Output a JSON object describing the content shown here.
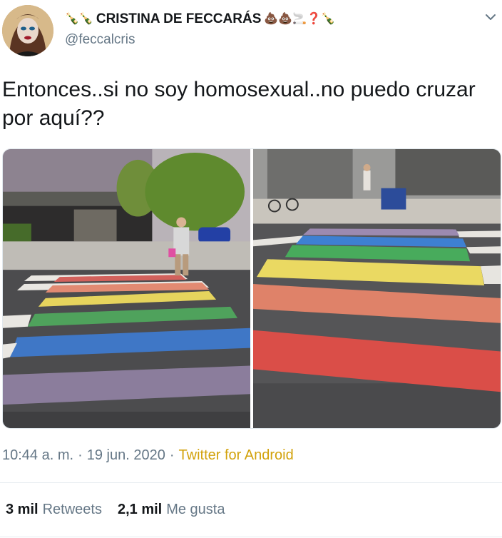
{
  "author": {
    "display_name": "CRISTINA DE FECCARÁS",
    "emoji_before": "🍾🍾",
    "emoji_after": "💩💩🚬❓🍾",
    "handle": "@feccalcris"
  },
  "icons": {
    "avatar": "profile-photo",
    "caret": "chevron-down-icon"
  },
  "tweet": {
    "text": "Entonces..si no soy homosexual..no puedo cruzar por aquí??",
    "time": "10:44 a. m.",
    "separator": "·",
    "date": "19 jun. 2020",
    "source": "Twitter for Android"
  },
  "stats": {
    "retweets_count": "3 mil",
    "retweets_label": "Retweets",
    "likes_count": "2,1 mil",
    "likes_label": "Me gusta"
  },
  "colors": {
    "text": "#14171a",
    "secondary": "#657786",
    "source": "#d2a20c",
    "divider": "#e6ecf0"
  }
}
